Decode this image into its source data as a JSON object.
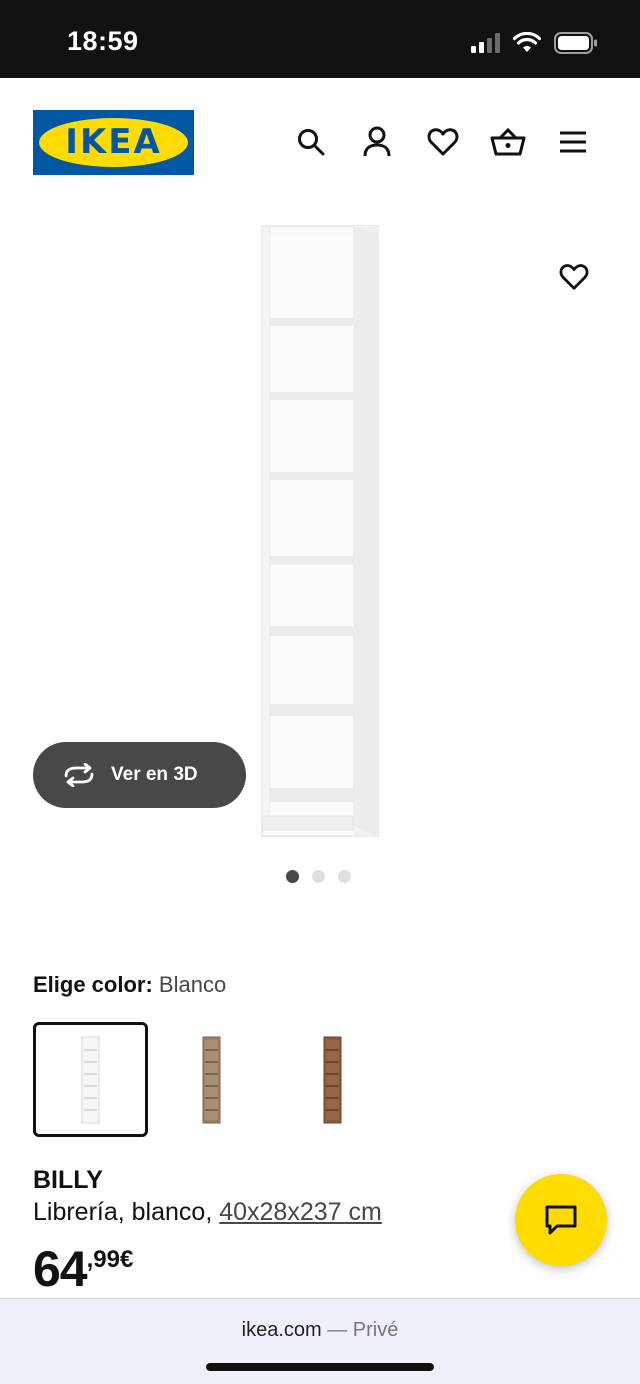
{
  "status_bar": {
    "time": "18:59"
  },
  "header": {
    "logo_text": "IKEA",
    "icons": [
      "search-icon",
      "account-icon",
      "wishlist-heart-icon",
      "basket-icon",
      "menu-icon"
    ]
  },
  "gallery": {
    "view_3d_label": "Ver en 3D",
    "slide_count": 3,
    "active_slide": 1
  },
  "color_picker": {
    "label": "Elige color:",
    "selected": "Blanco",
    "options": [
      {
        "name": "Blanco",
        "color": "#f4f4f2"
      },
      {
        "name": "oak",
        "color": "#9a8166"
      },
      {
        "name": "brown",
        "color": "#8a5a3e"
      }
    ]
  },
  "product": {
    "name": "BILLY",
    "description_prefix": "Librería, blanco, ",
    "dimensions": "40x28x237 cm",
    "price_integer": "64",
    "price_decimal": ",99€"
  },
  "browser": {
    "domain": "ikea.com",
    "mode": " — Privé"
  },
  "colors": {
    "ikea_blue": "#0058a3",
    "ikea_yellow": "#ffdb00",
    "dark_gray": "#484848"
  }
}
